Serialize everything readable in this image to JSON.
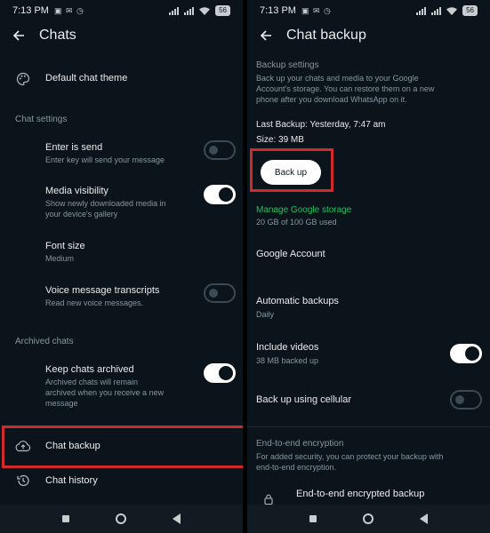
{
  "status": {
    "time": "7:13 PM",
    "icons": "▣ ✉ ◷",
    "battery": "56"
  },
  "left": {
    "title": "Chats",
    "default_theme": "Default chat theme",
    "chat_settings_header": "Chat settings",
    "enter_is_send": {
      "title": "Enter is send",
      "subtitle": "Enter key will send your message",
      "enabled": false
    },
    "media_visibility": {
      "title": "Media visibility",
      "subtitle_1": "Show newly downloaded media in",
      "subtitle_2": "your device's gallery",
      "enabled": true
    },
    "font_size": {
      "title": "Font size",
      "value": "Medium"
    },
    "voice_transcripts": {
      "title": "Voice message transcripts",
      "subtitle": "Read new voice messages.",
      "enabled": false
    },
    "archived_header": "Archived chats",
    "keep_archived": {
      "title": "Keep chats archived",
      "subtitle_1": "Archived chats will remain",
      "subtitle_2": "archived when you receive a new",
      "subtitle_3": "message",
      "enabled": true
    },
    "chat_backup": "Chat backup",
    "chat_history": "Chat history"
  },
  "right": {
    "title": "Chat backup",
    "backup_settings_header": "Backup settings",
    "description_1": "Back up your chats and media to your Google",
    "description_2": "Account's storage. You can restore them on a new",
    "description_3": "phone after you download WhatsApp on it.",
    "last_backup": "Last Backup: Yesterday, 7:47 am",
    "size": "Size: 39 MB",
    "backup_button": "Back up",
    "manage_storage": "Manage Google storage",
    "storage_used": "20 GB of 100 GB used",
    "google_account": "Google Account",
    "automatic_backups": {
      "title": "Automatic backups",
      "value": "Daily"
    },
    "include_videos": {
      "title": "Include videos",
      "subtitle": "38 MB backed up",
      "enabled": true
    },
    "cellular": {
      "title": "Back up using cellular",
      "enabled": false
    },
    "e2e_header": "End-to-end encryption",
    "e2e_desc_1": "For added security, you can protect your backup with",
    "e2e_desc_2": "end-to-end encryption.",
    "e2e_backup": "End-to-end encrypted backup"
  },
  "colors": {
    "background": "#0b141a",
    "accent_green": "#21c063",
    "highlight_red": "#d12a2a",
    "secondary_text": "#8696a0"
  }
}
